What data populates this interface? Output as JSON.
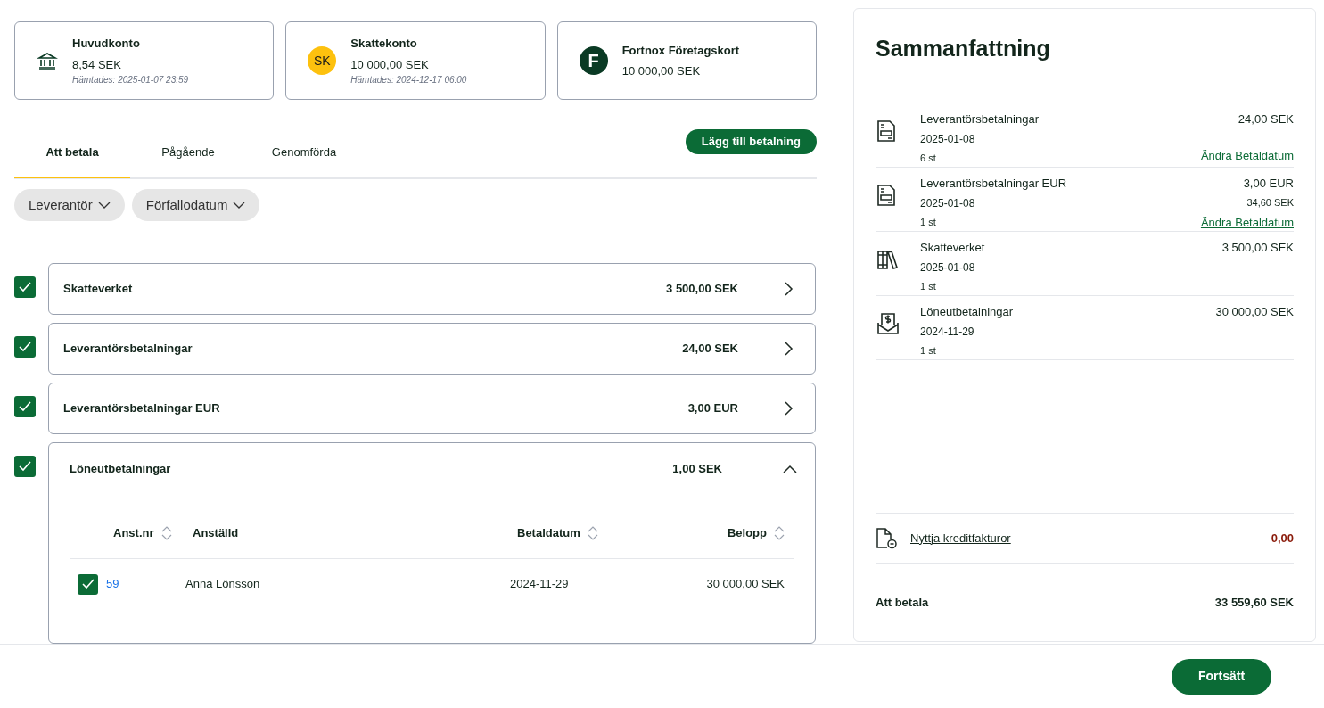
{
  "accounts": [
    {
      "kind": "bank",
      "name": "Huvudkonto",
      "amount": "8,54 SEK",
      "fetched": "Hämtades: 2025-01-07 23:59"
    },
    {
      "kind": "badge",
      "badge": "SK",
      "name": "Skattekonto",
      "amount": "10 000,00 SEK",
      "fetched": "Hämtades: 2024-12-17 06:00"
    },
    {
      "kind": "logo",
      "badge": "F",
      "name": "Fortnox Företagskort",
      "amount": "10 000,00 SEK"
    }
  ],
  "tabs": [
    {
      "label": "Att betala",
      "selected": true
    },
    {
      "label": "Pågående",
      "selected": false
    },
    {
      "label": "Genomförda",
      "selected": false
    }
  ],
  "add_button": "Lägg till betalning",
  "filters": [
    "Leverantör",
    "Förfallodatum"
  ],
  "groups": [
    {
      "name": "Skatteverket",
      "amount": "3 500,00 SEK",
      "checked": true,
      "expanded": false
    },
    {
      "name": "Leverantörsbetalningar",
      "amount": "24,00 SEK",
      "checked": true,
      "expanded": false
    },
    {
      "name": "Leverantörsbetalningar EUR",
      "amount": "3,00 EUR",
      "checked": true,
      "expanded": false
    },
    {
      "name": "Löneutbetalningar",
      "amount": "1,00 SEK",
      "checked": true,
      "expanded": true,
      "table": {
        "columns": [
          {
            "label": "Anst.nr",
            "sortable": true
          },
          {
            "label": "Anställd",
            "sortable": false
          },
          {
            "label": "Betaldatum",
            "sortable": true
          },
          {
            "label": "Belopp",
            "sortable": true
          }
        ],
        "rows": [
          {
            "checked": true,
            "number": "59",
            "employee": "Anna Lönsson",
            "date": "2024-11-29",
            "amount": "30 000,00 SEK"
          }
        ]
      }
    }
  ],
  "summary": {
    "title": "Sammanfattning",
    "items": [
      {
        "kind": "invoice",
        "name": "Leverantörsbetalningar",
        "date": "2025-01-08",
        "count": "6 st",
        "amount": "24,00 SEK",
        "link": "Ändra Betaldatum"
      },
      {
        "kind": "invoice",
        "name": "Leverantörsbetalningar EUR",
        "date": "2025-01-08",
        "count": "1 st",
        "amount": "3,00 EUR",
        "sub_amount": "34,60 SEK",
        "link": "Ändra Betaldatum"
      },
      {
        "kind": "books",
        "name": "Skatteverket",
        "date": "2025-01-08",
        "count": "1 st",
        "amount": "3 500,00 SEK"
      },
      {
        "kind": "salary",
        "name": "Löneutbetalningar",
        "date": "2024-11-29",
        "count": "1 st",
        "amount": "30 000,00 SEK"
      }
    ],
    "credit_link": "Nyttja kreditfakturor",
    "credit_amount": "0,00",
    "total_label": "Att betala",
    "total": "33 559,60 SEK"
  },
  "continue_button": "Fortsätt"
}
